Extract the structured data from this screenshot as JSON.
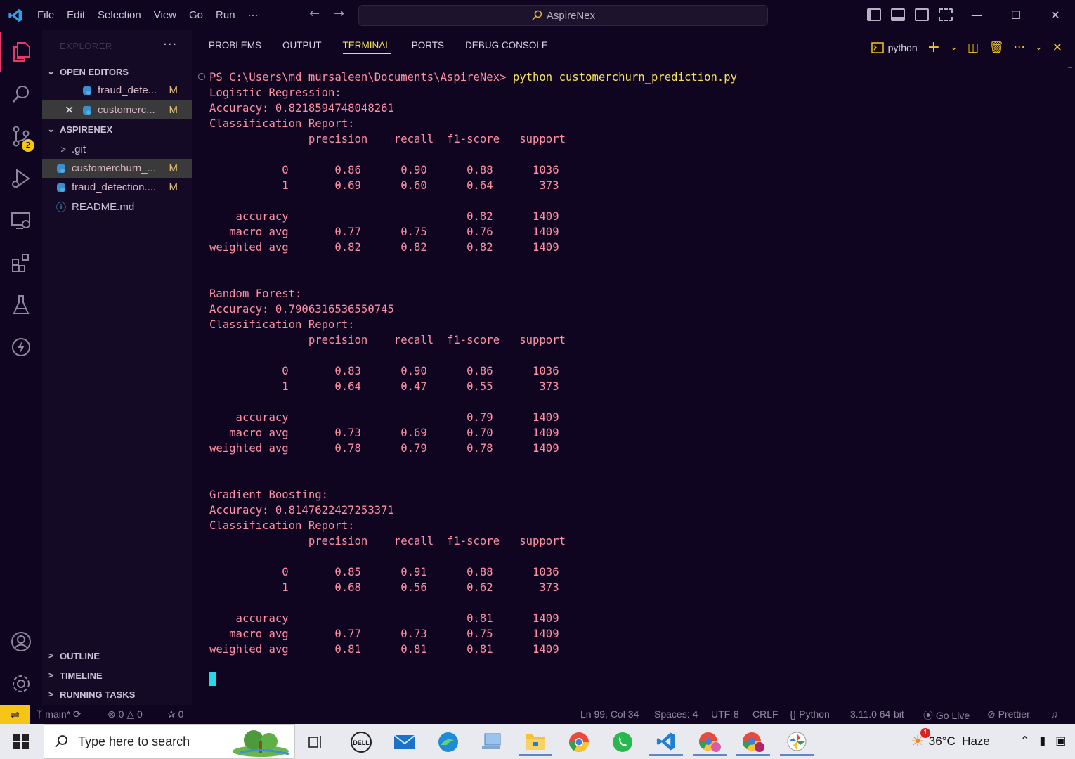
{
  "titlebar": {
    "menu": [
      "File",
      "Edit",
      "Selection",
      "View",
      "Go",
      "Run",
      "···"
    ],
    "search_text": "AspireNex",
    "icons": [
      "vscode-logo-icon",
      "back-arrow-icon",
      "forward-arrow-icon",
      "search-icon",
      "toggle-primary-sidebar-icon",
      "toggle-panel-icon",
      "toggle-secondary-sidebar-icon",
      "customize-layout-icon",
      "minimize-icon",
      "maximize-icon",
      "close-icon"
    ]
  },
  "activitybar": {
    "scm_badge": "2",
    "items": [
      "explorer-icon",
      "search-icon",
      "source-control-icon",
      "run-debug-icon",
      "remote-explorer-icon",
      "extensions-icon",
      "testing-icon",
      "thunder-icon",
      "account-icon",
      "settings-gear-icon"
    ]
  },
  "sidebar": {
    "title": "EXPLORER",
    "more": "···",
    "open_editors": {
      "label": "OPEN EDITORS",
      "files": [
        {
          "name": "fraud_dete...",
          "status": "M"
        },
        {
          "name": "customerc...",
          "status": "M"
        }
      ]
    },
    "folder": {
      "label": "ASPIRENEX",
      "items": [
        {
          "name": ".git",
          "status": ""
        },
        {
          "name": "customerchurn_...",
          "status": "M"
        },
        {
          "name": "fraud_detection....",
          "status": "M"
        },
        {
          "name": "README.md",
          "status": ""
        }
      ]
    },
    "outline": "OUTLINE",
    "timeline": "TIMELINE",
    "running_tasks": "RUNNING TASKS"
  },
  "panel": {
    "tabs": [
      "PROBLEMS",
      "OUTPUT",
      "TERMINAL",
      "PORTS",
      "DEBUG CONSOLE"
    ],
    "active_tab": "TERMINAL",
    "terminal_name": "python",
    "colors": {
      "output": "#ff8fa3",
      "command": "#f5e05a",
      "active_tab": "#f5e05a",
      "cursor": "#26d9e8"
    },
    "prompt": "PS C:\\Users\\md mursaleen\\Documents\\AspireNex> ",
    "command": "python customerchurn_prediction.py",
    "output": [
      "Logistic Regression:",
      "Accuracy: 0.8218594748048261",
      "Classification Report:",
      "               precision    recall  f1-score   support",
      "",
      "           0       0.86      0.90      0.88      1036",
      "           1       0.69      0.60      0.64       373",
      "",
      "    accuracy                           0.82      1409",
      "   macro avg       0.77      0.75      0.76      1409",
      "weighted avg       0.82      0.82      0.82      1409",
      "",
      "",
      "Random Forest:",
      "Accuracy: 0.7906316536550745",
      "Classification Report:",
      "               precision    recall  f1-score   support",
      "",
      "           0       0.83      0.90      0.86      1036",
      "           1       0.64      0.47      0.55       373",
      "",
      "    accuracy                           0.79      1409",
      "   macro avg       0.73      0.69      0.70      1409",
      "weighted avg       0.78      0.79      0.78      1409",
      "",
      "",
      "Gradient Boosting:",
      "Accuracy: 0.8147622427253371",
      "Classification Report:",
      "               precision    recall  f1-score   support",
      "",
      "           0       0.85      0.91      0.88      1036",
      "           1       0.68      0.56      0.62       373",
      "",
      "    accuracy                           0.81      1409",
      "   macro avg       0.77      0.73      0.75      1409",
      "weighted avg       0.81      0.81      0.81      1409"
    ]
  },
  "statusbar": {
    "branch": "main*",
    "errors": "0",
    "warnings": "0",
    "ports": "0",
    "position": "Ln 99, Col 34",
    "spaces": "Spaces: 4",
    "encoding": "UTF-8",
    "eol": "CRLF",
    "language": "Python",
    "interpreter": "3.11.0 64-bit",
    "golive": "Go Live",
    "prettier": "Prettier"
  },
  "taskbar": {
    "search_placeholder": "Type here to search",
    "apps": [
      "task-view-icon",
      "dell-icon",
      "mail-icon",
      "edge-icon",
      "computer-icon",
      "file-explorer-icon",
      "chrome-icon",
      "whatsapp-icon",
      "vscode-icon",
      "chrome-profile-md-icon",
      "chrome-profile-m-icon",
      "pinwheel-app-icon"
    ],
    "weather_badge": "1",
    "weather": "36°C  Haze"
  }
}
